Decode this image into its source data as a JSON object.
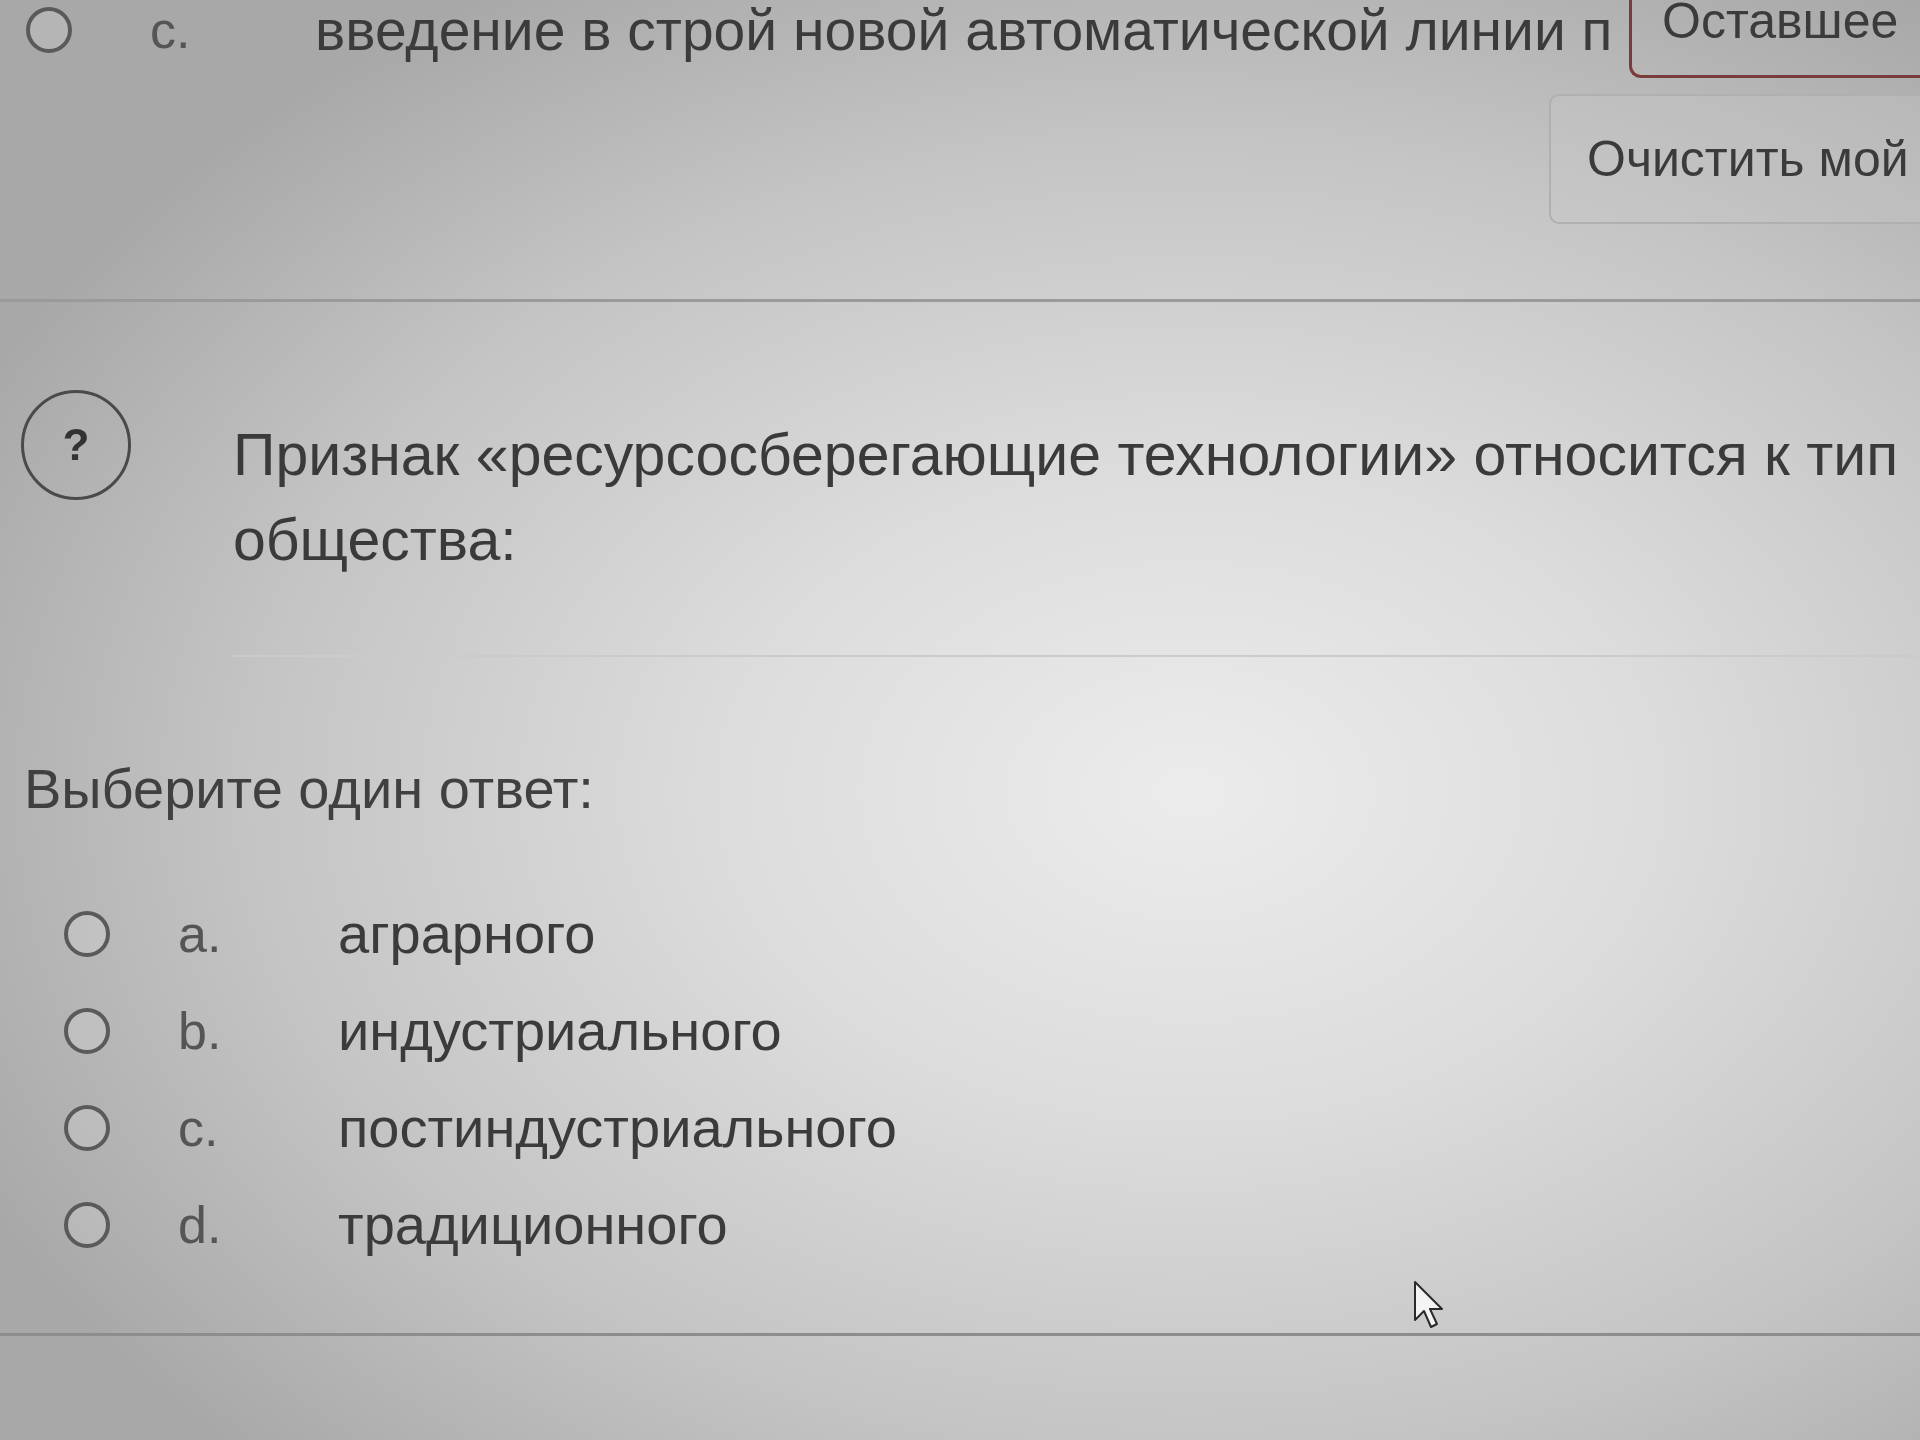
{
  "previous_question": {
    "option": {
      "letter": "c.",
      "text": "введение в строй новой автоматической линии п",
      "selected": false
    },
    "clear_button": {
      "label": "Очистить мой"
    }
  },
  "timer": {
    "label": "Оставшее"
  },
  "question": {
    "icon": "?",
    "text_lines": [
      "Признак «ресурсосберегающие технологии» относится к тип",
      "общества:"
    ],
    "prompt": "Выберите один ответ:",
    "options": [
      {
        "letter": "a.",
        "text": "аграрного",
        "selected": false
      },
      {
        "letter": "b.",
        "text": "индустриального",
        "selected": false
      },
      {
        "letter": "c.",
        "text": "постиндустриального",
        "selected": false
      },
      {
        "letter": "d.",
        "text": "традиционного",
        "selected": false
      }
    ]
  }
}
